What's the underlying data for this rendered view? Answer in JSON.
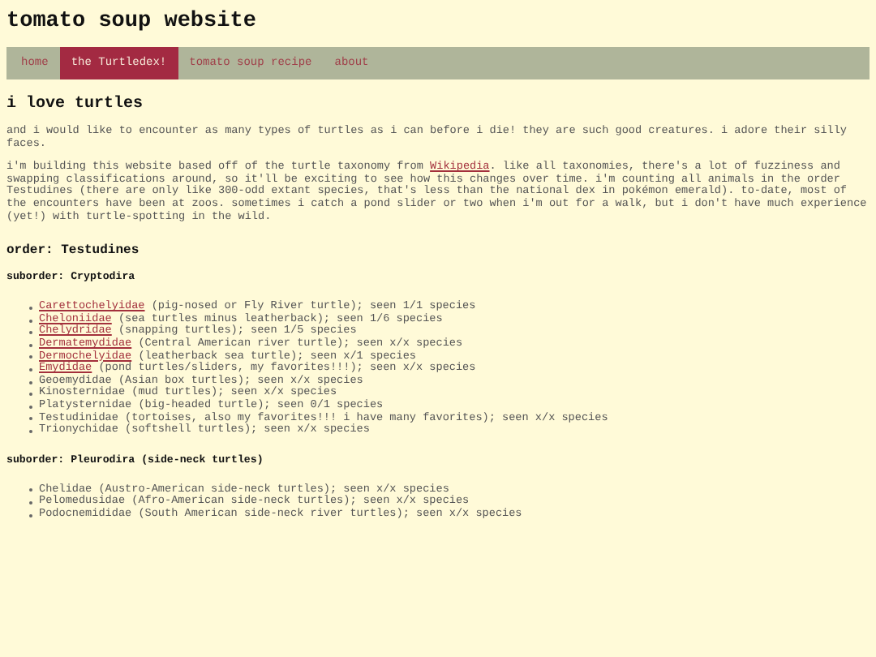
{
  "site_title": "tomato soup website",
  "nav": [
    {
      "label": "home",
      "selected": false
    },
    {
      "label": "the Turtledex!",
      "selected": true
    },
    {
      "label": "tomato soup recipe",
      "selected": false
    },
    {
      "label": "about",
      "selected": false
    }
  ],
  "heading": "i love turtles",
  "intro": "and i would like to encounter as many types of turtles as i can before i die! they are such good creatures. i adore their silly faces.",
  "paragraph": {
    "before": "i'm building this website based off of the turtle taxonomy from ",
    "link": "Wikipedia",
    "after": ". like all taxonomies, there's a lot of fuzziness and swapping classifications around, so it'll be exciting to see how this changes over time. i'm counting all animals in the order Testudines (there are only like 300-odd extant species, that's less than the national dex in pokémon emerald). to-date, most of the encounters have been at zoos. sometimes i catch a pond slider or two when i'm out for a walk, but i don't have much experience (yet!) with turtle-spotting in the wild."
  },
  "order": "order: Testudines",
  "suborders": [
    {
      "title": "suborder: Cryptodira",
      "families": [
        {
          "name": "Carettochelyidae",
          "linked": true,
          "rest": " (pig-nosed or Fly River turtle); seen 1/1 species"
        },
        {
          "name": "Cheloniidae",
          "linked": true,
          "rest": " (sea turtles minus leatherback); seen 1/6 species"
        },
        {
          "name": "Chelydridae",
          "linked": true,
          "rest": " (snapping turtles); seen 1/5 species"
        },
        {
          "name": "Dermatemydidae",
          "linked": true,
          "rest": " (Central American river turtle); seen x/x species"
        },
        {
          "name": "Dermochelyidae",
          "linked": true,
          "rest": " (leatherback sea turtle); seen x/1 species"
        },
        {
          "name": "Emydidae",
          "linked": true,
          "rest": " (pond turtles/sliders, my favorites!!!); seen x/x species"
        },
        {
          "name": "Geoemydidae",
          "linked": false,
          "rest": " (Asian box turtles); seen x/x species"
        },
        {
          "name": "Kinosternidae",
          "linked": false,
          "rest": " (mud turtles); seen x/x species"
        },
        {
          "name": "Platysternidae",
          "linked": false,
          "rest": " (big-headed turtle); seen 0/1 species"
        },
        {
          "name": "Testudinidae",
          "linked": false,
          "rest": " (tortoises, also my favorites!!! i have many favorites); seen x/x species"
        },
        {
          "name": "Trionychidae",
          "linked": false,
          "rest": " (softshell turtles); seen x/x species"
        }
      ]
    },
    {
      "title": "suborder: Pleurodira (side-neck turtles)",
      "families": [
        {
          "name": "Chelidae",
          "linked": false,
          "rest": " (Austro-American side-neck turtles); seen x/x species"
        },
        {
          "name": "Pelomedusidae",
          "linked": false,
          "rest": " (Afro-American side-neck turtles); seen x/x species"
        },
        {
          "name": "Podocnemididae",
          "linked": false,
          "rest": " (South American side-neck river turtles); seen x/x species"
        }
      ]
    }
  ]
}
